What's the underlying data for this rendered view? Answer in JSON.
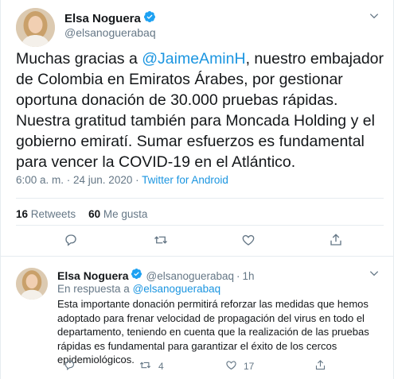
{
  "tweet": {
    "author_name": "Elsa Noguera",
    "author_handle": "@elsanoguerabaq",
    "text_before": "Muchas gracias a ",
    "mention": "@JaimeAminH",
    "text_after": ", nuestro embajador de Colombia en Emiratos Árabes, por gestionar oportuna donación de 30.000 pruebas rápidas. Nuestra gratitud también para Moncada Holding y el gobierno emiratí. Sumar esfuerzos es fundamental para vencer la COVID-19 en el Atlántico.",
    "timestamp": "6:00 a. m. · 24 jun. 2020",
    "separator": "·",
    "source": "Twitter for Android",
    "retweets_count": "16",
    "retweets_label": "Retweets",
    "likes_count": "60",
    "likes_label": "Me gusta"
  },
  "reply": {
    "author_name": "Elsa Noguera",
    "author_handle": "@elsanoguerabaq",
    "time_sep": "·",
    "time": "1h",
    "reply_prefix": "En respuesta a",
    "reply_to": "@elsanoguerabaq",
    "text": "Esta importante donación permitirá reforzar las medidas que hemos adoptado para frenar velocidad de propagación del virus en todo el departamento, teniendo en cuenta que la realización de las pruebas rápidas es fundamental para garantizar el éxito de los cercos epidemiológicos.",
    "retweet_count": "4",
    "like_count": "17"
  },
  "icons": {
    "verified": "verified-badge-icon",
    "chevron": "chevron-down-icon",
    "reply": "reply-icon",
    "retweet": "retweet-icon",
    "like": "heart-icon",
    "share": "share-icon"
  },
  "colors": {
    "link": "#1b95e0",
    "secondary_text": "#657786",
    "divider": "#e6ecf0",
    "verified": "#1da1f2"
  }
}
